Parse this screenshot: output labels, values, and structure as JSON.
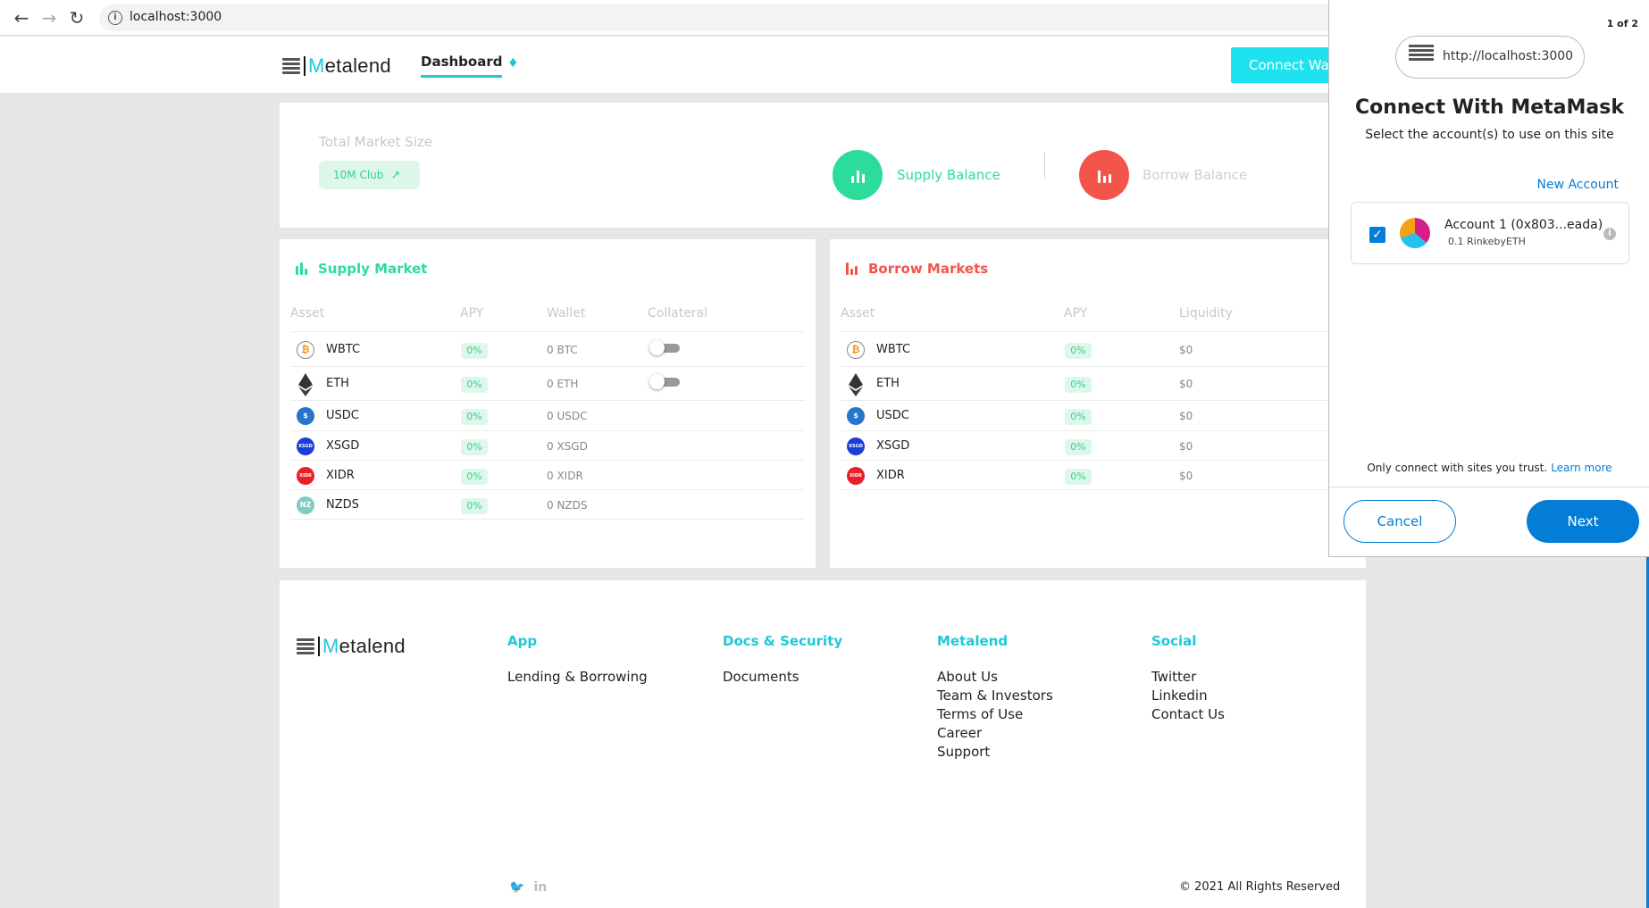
{
  "browser": {
    "url": "localhost:3000",
    "back_icon": "←",
    "forward_icon": "→",
    "reload_icon": "↻"
  },
  "header": {
    "logo_prefix": "M",
    "logo_rest": "etalend",
    "nav_dashboard": "Dashboard",
    "connect_button": "Connect Wallet"
  },
  "overview": {
    "total_market_size": "Total Market Size",
    "club_badge": "10M Club",
    "supply_balance": "Supply Balance",
    "borrow_balance": "Borrow Balance"
  },
  "supply_market": {
    "title": "Supply Market",
    "columns": [
      "Asset",
      "APY",
      "Wallet",
      "Collateral"
    ],
    "rows": [
      {
        "asset": "WBTC",
        "apy": "0%",
        "wallet": "0 BTC",
        "collateral_toggle": true
      },
      {
        "asset": "ETH",
        "apy": "0%",
        "wallet": "0 ETH",
        "collateral_toggle": true
      },
      {
        "asset": "USDC",
        "apy": "0%",
        "wallet": "0 USDC",
        "collateral_toggle": false
      },
      {
        "asset": "XSGD",
        "apy": "0%",
        "wallet": "0 XSGD",
        "collateral_toggle": false
      },
      {
        "asset": "XIDR",
        "apy": "0%",
        "wallet": "0 XIDR",
        "collateral_toggle": false
      },
      {
        "asset": "NZDS",
        "apy": "0%",
        "wallet": "0 NZDS",
        "collateral_toggle": false
      }
    ]
  },
  "borrow_market": {
    "title": "Borrow Markets",
    "columns": [
      "Asset",
      "APY",
      "Liquidity"
    ],
    "rows": [
      {
        "asset": "WBTC",
        "apy": "0%",
        "liquidity": "$0"
      },
      {
        "asset": "ETH",
        "apy": "0%",
        "liquidity": "$0"
      },
      {
        "asset": "USDC",
        "apy": "0%",
        "liquidity": "$0"
      },
      {
        "asset": "XSGD",
        "apy": "0%",
        "liquidity": "$0"
      },
      {
        "asset": "XIDR",
        "apy": "0%",
        "liquidity": "$0"
      }
    ]
  },
  "footer": {
    "columns": [
      {
        "heading": "App",
        "links": [
          "Lending & Borrowing"
        ]
      },
      {
        "heading": "Docs & Security",
        "links": [
          "Documents"
        ]
      },
      {
        "heading": "Metalend",
        "links": [
          "About Us",
          "Team & Investors",
          "Terms of Use",
          "Career",
          "Support"
        ]
      },
      {
        "heading": "Social",
        "links": [
          "Twitter",
          "Linkedin",
          "Contact Us"
        ]
      }
    ],
    "copyright": "© 2021 All Rights Reserved",
    "twitter_glyph": "🐦",
    "linkedin_glyph": "in"
  },
  "metamask": {
    "step": "1 of 2",
    "origin": "http://localhost:3000",
    "title": "Connect With MetaMask",
    "subtitle": "Select the account(s) to use on this site",
    "new_account": "New Account",
    "account_name": "Account 1 (0x803...eada)",
    "account_balance": "0.1 RinkebyETH",
    "trust_text": "Only connect with sites you trust.",
    "learn_more": "Learn more",
    "cancel": "Cancel",
    "next": "Next"
  },
  "colors": {
    "accent": "#1ec8d8",
    "supply": "#2bdc9a",
    "borrow": "#f2564a",
    "metamask_blue": "#037dd6"
  },
  "icons": {
    "WBTC": {
      "glyph": "₿",
      "color": "#f7931a"
    },
    "ETH": {
      "glyph": "◆",
      "color": "#3c3c3d"
    },
    "USDC": {
      "glyph": "$",
      "color": "#2775ca"
    },
    "XSGD": {
      "glyph": "XSGD",
      "color": "#1a3ed8"
    },
    "XIDR": {
      "glyph": "XIDR",
      "color": "#e8202a"
    },
    "NZDS": {
      "glyph": "NZ",
      "color": "#7fcdc0"
    }
  }
}
